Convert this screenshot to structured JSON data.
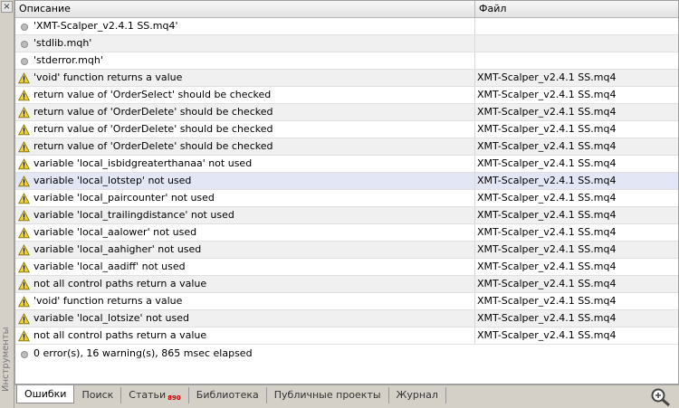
{
  "sidebar": {
    "close_glyph": "×",
    "title": "Инструменты"
  },
  "header": {
    "col_desc": "Описание",
    "col_file": "Файл"
  },
  "rows": [
    {
      "icon": "info",
      "desc": "'XMT-Scalper_v2.4.1 SS.mq4'",
      "file": ""
    },
    {
      "icon": "info",
      "desc": "'stdlib.mqh'",
      "file": ""
    },
    {
      "icon": "info",
      "desc": "'stderror.mqh'",
      "file": ""
    },
    {
      "icon": "warning",
      "desc": "'void' function returns a value",
      "file": "XMT-Scalper_v2.4.1 SS.mq4"
    },
    {
      "icon": "warning",
      "desc": "return value of 'OrderSelect' should be checked",
      "file": "XMT-Scalper_v2.4.1 SS.mq4"
    },
    {
      "icon": "warning",
      "desc": "return value of 'OrderDelete' should be checked",
      "file": "XMT-Scalper_v2.4.1 SS.mq4"
    },
    {
      "icon": "warning",
      "desc": "return value of 'OrderDelete' should be checked",
      "file": "XMT-Scalper_v2.4.1 SS.mq4"
    },
    {
      "icon": "warning",
      "desc": "return value of 'OrderDelete' should be checked",
      "file": "XMT-Scalper_v2.4.1 SS.mq4"
    },
    {
      "icon": "warning",
      "desc": "variable 'local_isbidgreaterthanaa' not used",
      "file": "XMT-Scalper_v2.4.1 SS.mq4"
    },
    {
      "icon": "warning",
      "desc": "variable 'local_lotstep' not used",
      "file": "XMT-Scalper_v2.4.1 SS.mq4",
      "selected": true
    },
    {
      "icon": "warning",
      "desc": "variable 'local_paircounter' not used",
      "file": "XMT-Scalper_v2.4.1 SS.mq4"
    },
    {
      "icon": "warning",
      "desc": "variable 'local_trailingdistance' not used",
      "file": "XMT-Scalper_v2.4.1 SS.mq4"
    },
    {
      "icon": "warning",
      "desc": "variable 'local_aalower' not used",
      "file": "XMT-Scalper_v2.4.1 SS.mq4"
    },
    {
      "icon": "warning",
      "desc": "variable 'local_aahigher' not used",
      "file": "XMT-Scalper_v2.4.1 SS.mq4"
    },
    {
      "icon": "warning",
      "desc": "variable 'local_aadiff' not used",
      "file": "XMT-Scalper_v2.4.1 SS.mq4"
    },
    {
      "icon": "warning",
      "desc": "not all control paths return a value",
      "file": "XMT-Scalper_v2.4.1 SS.mq4"
    },
    {
      "icon": "warning",
      "desc": "'void' function returns a value",
      "file": "XMT-Scalper_v2.4.1 SS.mq4"
    },
    {
      "icon": "warning",
      "desc": "variable 'local_lotsize' not used",
      "file": "XMT-Scalper_v2.4.1 SS.mq4"
    },
    {
      "icon": "warning",
      "desc": "not all control paths return a value",
      "file": "XMT-Scalper_v2.4.1 SS.mq4"
    }
  ],
  "summary": {
    "icon": "info",
    "text": "0 error(s), 16 warning(s), 865 msec elapsed"
  },
  "tabs": [
    {
      "label": "Ошибки",
      "active": true
    },
    {
      "label": "Поиск"
    },
    {
      "label": "Статьи",
      "badge": "890"
    },
    {
      "label": "Библиотека"
    },
    {
      "label": "Публичные проекты"
    },
    {
      "label": "Журнал"
    }
  ],
  "colors": {
    "warning_fill": "#f2d52b",
    "info_dot": "#bdbdbd",
    "selected_row": "#e3e6f5",
    "badge": "#cc0000"
  },
  "icons": {
    "warning": "warning-triangle-icon",
    "info": "info-dot-icon",
    "zoom": "zoom-magnifier-icon"
  }
}
